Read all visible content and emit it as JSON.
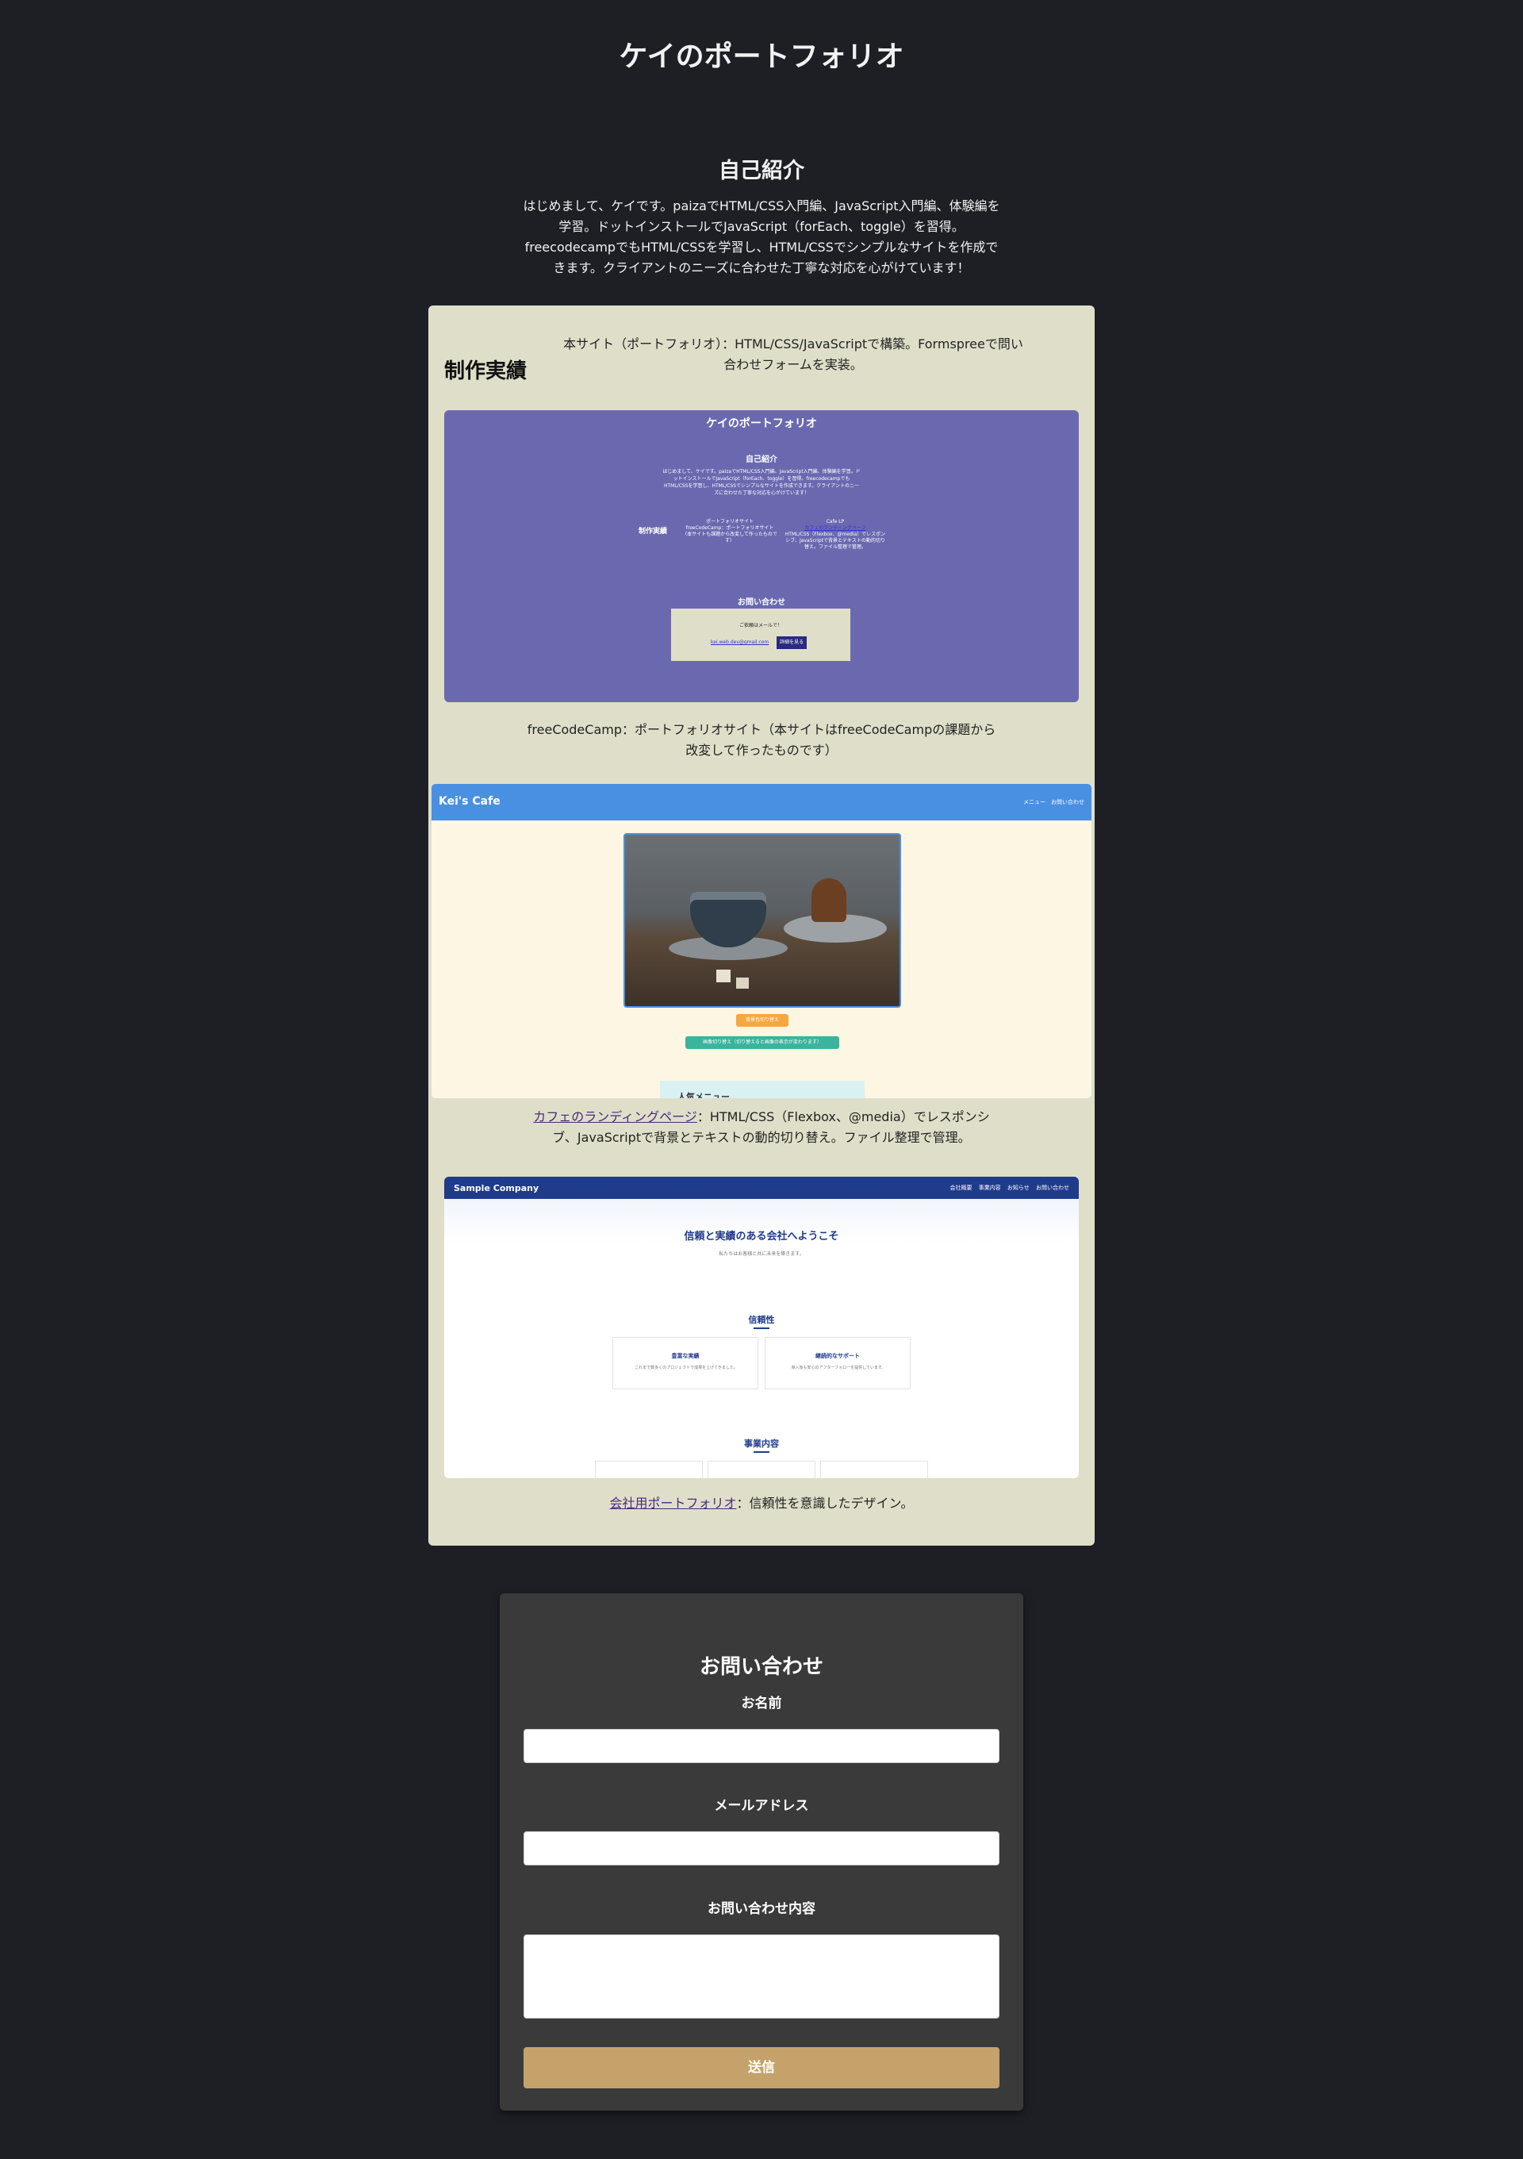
{
  "site": {
    "title": "ケイのポートフォリオ"
  },
  "about": {
    "title": "自己紹介",
    "text": "はじめまして、ケイです。paizaでHTML/CSS入門編、JavaScript入門編、体験編を学習。ドットインストールでJavaScript（forEach、toggle）を習得。freecodecampでもHTML/CSSを学習し、HTML/CSSでシンプルなサイトを作成できます。クライアントのニーズに合わせた丁寧な対応を心がけています！"
  },
  "works": {
    "title": "制作実績",
    "items": [
      {
        "caption": "本サイト（ポートフォリオ）：HTML/CSS/JavaScriptで構築。Formspreeで問い合わせフォームを実装。",
        "preview": {
          "title": "ケイのポートフォリオ",
          "about_title": "自己紹介",
          "about_text": "はじめまして、ケイです。paizaでHTML/CSS入門編、JavaScript入門編、体験編を学習。ドットインストールでJavaScript（forEach、toggle）を習得。freecodecampでもHTML/CSSを学習し、HTML/CSSでシンプルなサイトを作成できます。クライアントのニーズに合わせた丁寧な対応を心がけています！",
          "works_title": "制作実績",
          "w1_alt": "ポートフォリオサイト",
          "w1_text": "freeCodeCamp：ポートフォリオサイト（本サイトも課題から改変して作ったものです）",
          "w2_alt": "Cafe LP",
          "w2_link": "カフェのランディングページ",
          "w2_text": "HTML/CSS（Flexbox、@media）でレスポンシブ、JavaScriptで背景とテキストの動的切り替え。ファイル整理で管理。",
          "contact_title": "お問い合わせ",
          "contact_text": "ご依頼はメールで！",
          "contact_email": "kei.web.dev@gmail.com",
          "contact_button": "詳細を見る"
        }
      },
      {
        "caption": "freeCodeCamp：ポートフォリオサイト（本サイトはfreeCodeCampの課題から改変して作ったものです）",
        "preview": {
          "brand": "Kei's Cafe",
          "nav": "メニュー　お問い合わせ",
          "btn_bg": "背景色切り替え",
          "btn_img": "画像切り替え（切り替えると画像の表示が変わります）",
          "menu_title": "人気メニュー"
        }
      },
      {
        "link": "カフェのランディングページ",
        "caption": "：HTML/CSS（Flexbox、@media）でレスポンシブ、JavaScriptで背景とテキストの動的切り替え。ファイル整理で管理。",
        "preview": {
          "brand": "Sample Company",
          "nav": "会社概要 事業内容 お知らせ お問い合わせ",
          "hero_title": "信頼と実績のある会社へようこそ",
          "hero_sub": "私たちはお客様と共に未来を築きます。",
          "sec1_title": "信頼性",
          "cards": [
            {
              "title": "豊富な実績",
              "text": "これまで数多くのプロジェクトで成果を上げてきました。"
            },
            {
              "title": "継続的なサポート",
              "text": "導入後も安心のアフターフォローを提供しています。"
            }
          ],
          "sec2_title": "事業内容"
        }
      },
      {
        "link": "会社用ポートフォリオ",
        "caption": "：信頼性を意識したデザイン。"
      }
    ]
  },
  "contact": {
    "title": "お問い合わせ",
    "name_label": "お名前",
    "email_label": "メールアドレス",
    "message_label": "お問い合わせ内容",
    "submit_label": "送信"
  },
  "colors": {
    "background": "#1d1f25",
    "works_panel": "#dfdfc9",
    "contact_panel": "#3a3a3a",
    "submit": "#c4a26a",
    "link": "#4b2a78"
  }
}
